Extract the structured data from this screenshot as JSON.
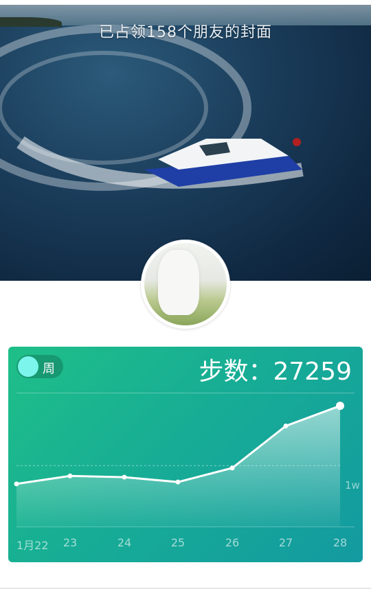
{
  "cover": {
    "caption": "已占领158个朋友的封面"
  },
  "profile": {
    "avatar_icon": "user-avatar"
  },
  "card": {
    "period_toggle": {
      "label": "周",
      "on": true
    },
    "steps_label": "步数：",
    "steps_value": "27259",
    "reference_line_label": "1w",
    "colors": {
      "start": "#1fbf88",
      "end": "#139aa0",
      "knob": "#7cf5ec"
    }
  },
  "chart_data": {
    "type": "area",
    "categories": [
      "1月22",
      "23",
      "24",
      "25",
      "26",
      "27",
      "28"
    ],
    "values": [
      7000,
      8300,
      8100,
      7300,
      9600,
      16500,
      19800
    ],
    "reference_line": 10000,
    "ylim": [
      0,
      25000
    ],
    "xlabel": "",
    "ylabel": "",
    "grid": false
  }
}
